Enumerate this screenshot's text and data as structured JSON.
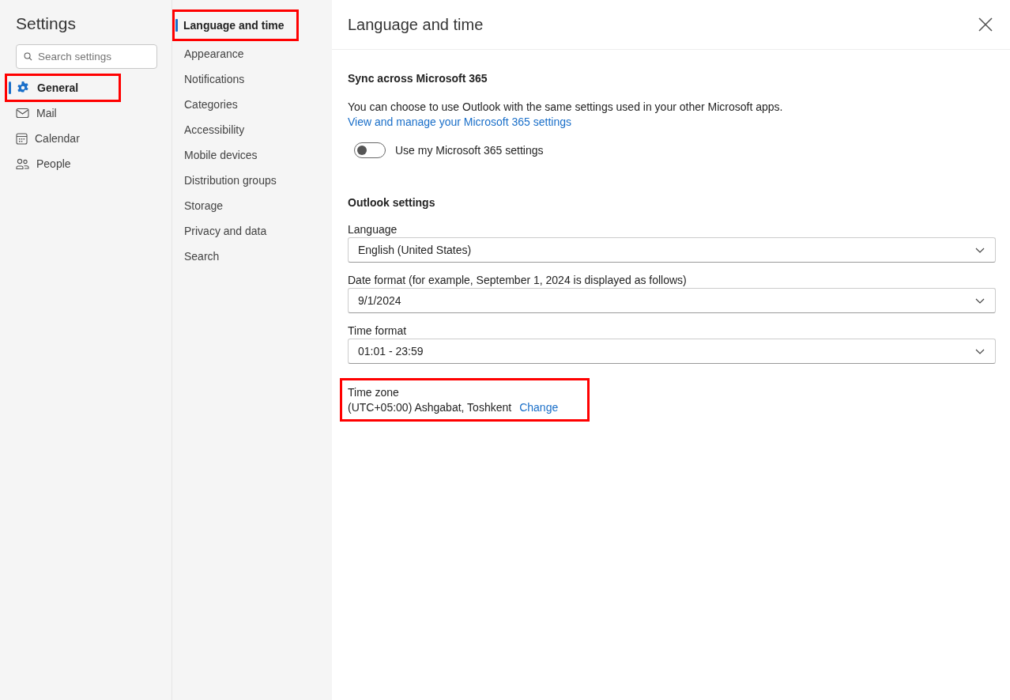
{
  "sidebar": {
    "title": "Settings",
    "search": {
      "placeholder": "Search settings"
    },
    "items": [
      {
        "label": "General",
        "selected": true,
        "highlighted": true
      },
      {
        "label": "Mail",
        "selected": false,
        "highlighted": false
      },
      {
        "label": "Calendar",
        "selected": false,
        "highlighted": false
      },
      {
        "label": "People",
        "selected": false,
        "highlighted": false
      }
    ]
  },
  "subnav": {
    "items": [
      {
        "label": "Language and time",
        "selected": true,
        "highlighted": true
      },
      {
        "label": "Appearance",
        "selected": false,
        "highlighted": false
      },
      {
        "label": "Notifications",
        "selected": false,
        "highlighted": false
      },
      {
        "label": "Categories",
        "selected": false,
        "highlighted": false
      },
      {
        "label": "Accessibility",
        "selected": false,
        "highlighted": false
      },
      {
        "label": "Mobile devices",
        "selected": false,
        "highlighted": false
      },
      {
        "label": "Distribution groups",
        "selected": false,
        "highlighted": false
      },
      {
        "label": "Storage",
        "selected": false,
        "highlighted": false
      },
      {
        "label": "Privacy and data",
        "selected": false,
        "highlighted": false
      },
      {
        "label": "Search",
        "selected": false,
        "highlighted": false
      }
    ]
  },
  "panel": {
    "title": "Language and time",
    "sync": {
      "heading": "Sync across Microsoft 365",
      "description": "You can choose to use Outlook with the same settings used in your other Microsoft apps.",
      "link": "View and manage your Microsoft 365 settings",
      "toggle": {
        "label": "Use my Microsoft 365 settings",
        "on": false
      }
    },
    "outlook": {
      "heading": "Outlook settings",
      "dropdowns": [
        {
          "label": "Language",
          "value": "English (United States)"
        },
        {
          "label": "Date format (for example, September 1, 2024 is displayed as follows)",
          "value": "9/1/2024"
        },
        {
          "label": "Time format",
          "value": "01:01 - 23:59"
        }
      ],
      "time_zone": {
        "label": "Time zone",
        "value": "(UTC+05:00) Ashgabat, Toshkent",
        "link": "Change",
        "highlighted": true
      }
    }
  }
}
